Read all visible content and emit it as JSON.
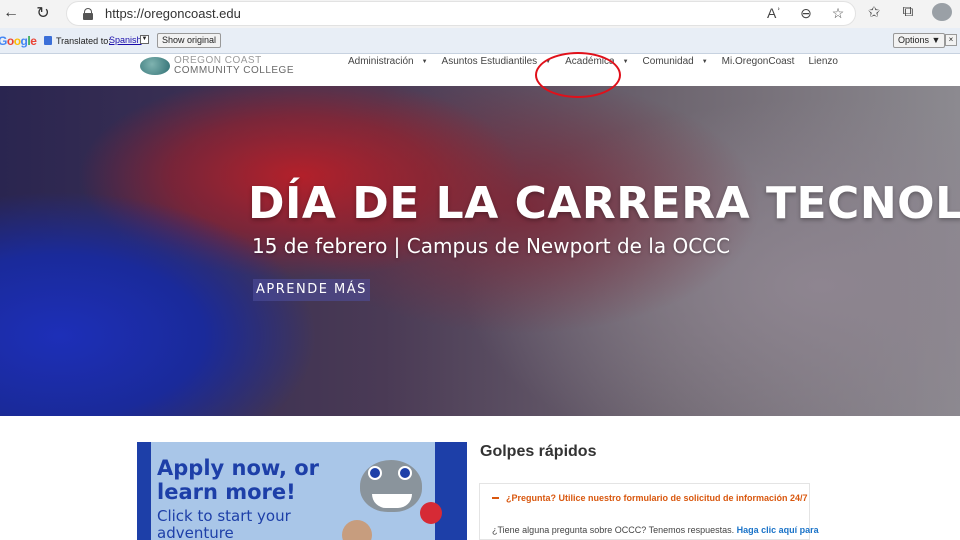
{
  "browser": {
    "url": "https://oregoncoast.edu",
    "icons": {
      "back": "←",
      "reload": "↻",
      "read_aloud": "Aʾ",
      "zoom": "⊖",
      "favorite": "☆",
      "favorites": "✩",
      "collections": "⧉"
    }
  },
  "translate_bar": {
    "logo": "Google",
    "translated_to_label": "Translated to:",
    "language": "Spanish",
    "show_original_label": "Show original",
    "options_label": "Options ▼",
    "close_label": "×"
  },
  "site_header": {
    "logo_line1": "OREGON COAST",
    "logo_line2": "COMMUNITY COLLEGE",
    "nav": [
      {
        "label": "Administración",
        "has_dropdown": true
      },
      {
        "label": "Asuntos Estudiantiles",
        "has_dropdown": true
      },
      {
        "label": "Académica",
        "has_dropdown": true
      },
      {
        "label": "Comunidad",
        "has_dropdown": true
      },
      {
        "label": "Mi.OregonCoast",
        "has_dropdown": false
      },
      {
        "label": "Lienzo",
        "has_dropdown": false
      }
    ]
  },
  "hero": {
    "title": "DÍA DE LA CARRERA TECNOLÓGICA",
    "subtitle": "15 de febrero | Campus de Newport de la OCCC",
    "cta_label": "APRENDE MÁS"
  },
  "promo": {
    "headline": "Apply now, or learn more!",
    "subline": "Click to start your adventure"
  },
  "quick_links": {
    "title": "Golpes rápidos",
    "faq_heading": "¿Pregunta? Utilice nuestro formulario de solicitud de información 24/7",
    "faq_body": "¿Tiene alguna pregunta sobre OCCC? Tenemos respuestas. ",
    "faq_link": "Haga clic aquí para"
  },
  "colors": {
    "accent_orange": "#d9580f",
    "brand_blue": "#1d3fa8",
    "annotation_red": "#e0101a"
  }
}
